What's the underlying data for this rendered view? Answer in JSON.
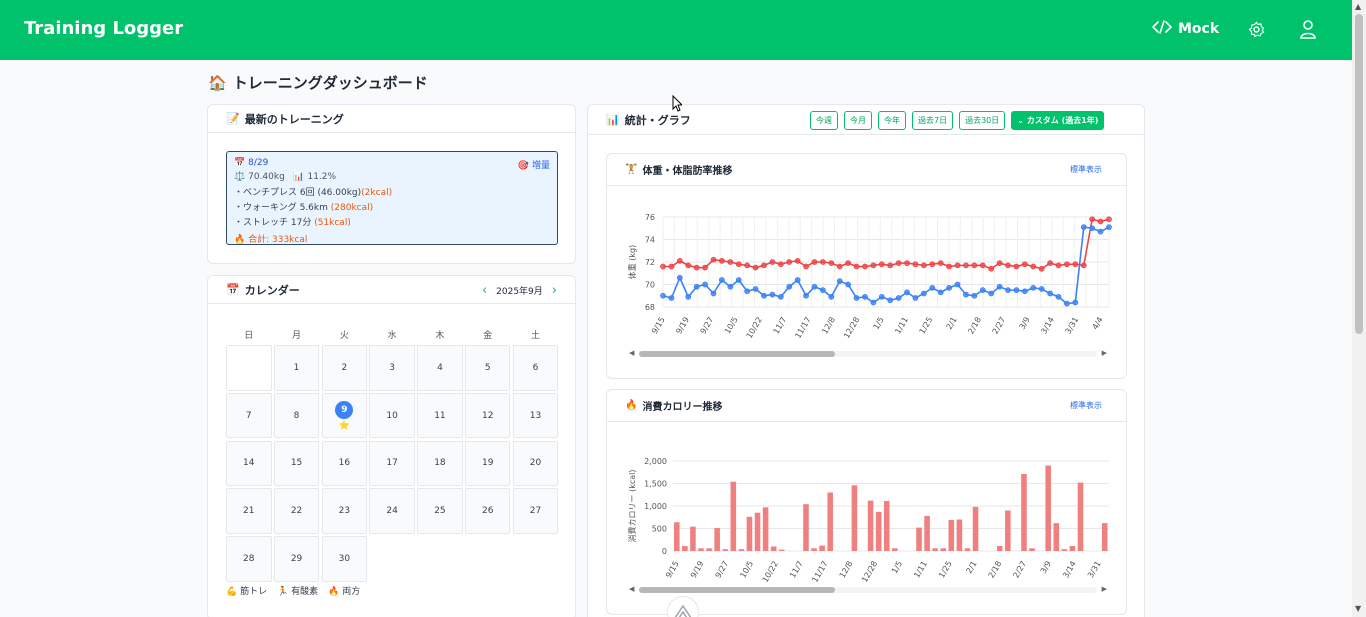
{
  "app": {
    "title": "Training Logger",
    "mock_label": "Mock"
  },
  "page": {
    "title": "トレーニングダッシュボード"
  },
  "latest": {
    "title": "最新のトレーニング",
    "date": "8/29",
    "increase": "増量",
    "weight": "70.40kg",
    "body_fat": "11.2%",
    "items": [
      {
        "text": "・ベンチプレス 6回 (46.00kg)",
        "kcal": "(2kcal)"
      },
      {
        "text": "・ウォーキング 5.6km ",
        "kcal": "(280kcal)"
      },
      {
        "text": "・ストレッチ 17分 ",
        "kcal": "(51kcal)"
      }
    ],
    "total": "合計: 333kcal"
  },
  "calendar": {
    "title": "カレンダー",
    "month": "2025年9月",
    "weekdays": [
      "日",
      "月",
      "火",
      "水",
      "木",
      "金",
      "土"
    ],
    "days": [
      "",
      "1",
      "2",
      "3",
      "4",
      "5",
      "6",
      "7",
      "8",
      "9",
      "10",
      "11",
      "12",
      "13",
      "14",
      "15",
      "16",
      "17",
      "18",
      "19",
      "20",
      "21",
      "22",
      "23",
      "24",
      "25",
      "26",
      "27",
      "28",
      "29",
      "30"
    ],
    "today": "9",
    "legend": [
      {
        "icon": "💪",
        "label": "筋トレ"
      },
      {
        "icon": "🏃",
        "label": "有酸素"
      },
      {
        "icon": "🔥",
        "label": "両方"
      }
    ]
  },
  "stats": {
    "title": "統計・グラフ",
    "ranges": [
      "今週",
      "今月",
      "今年",
      "過去7日",
      "過去30日"
    ],
    "custom": "カスタム (過去1年)"
  },
  "weight_chart": {
    "title": "体重・体脂肪率推移",
    "link": "標準表示",
    "chart_data": {
      "type": "line",
      "ylabel": "体重 (kg)",
      "ylim": [
        68,
        76
      ],
      "yticks": [
        68,
        70,
        72,
        74,
        76
      ],
      "x_labels": [
        "9/15",
        "9/19",
        "9/27",
        "10/5",
        "10/22",
        "11/7",
        "11/17",
        "12/8",
        "12/28",
        "1/5",
        "1/11",
        "1/25",
        "2/1",
        "2/18",
        "2/27",
        "3/9",
        "3/14",
        "3/31",
        "4/4"
      ],
      "series": [
        {
          "name": "red",
          "color": "#ef4444",
          "values": [
            71.6,
            71.6,
            72.1,
            71.7,
            71.5,
            71.5,
            72.2,
            72.1,
            72.0,
            71.8,
            71.7,
            71.5,
            71.7,
            72.0,
            71.8,
            72.0,
            72.1,
            71.6,
            72.0,
            72.0,
            71.9,
            71.6,
            71.9,
            71.6,
            71.6,
            71.7,
            71.8,
            71.7,
            71.9,
            71.9,
            71.8,
            71.7,
            71.8,
            71.9,
            71.6,
            71.7,
            71.7,
            71.7,
            71.7,
            71.4,
            71.9,
            71.7,
            71.6,
            71.8,
            71.6,
            71.4,
            71.9,
            71.7,
            71.8,
            71.8,
            71.7,
            75.8,
            75.6,
            75.8
          ]
        },
        {
          "name": "blue",
          "color": "#3b82f6",
          "values": [
            69.0,
            68.8,
            70.6,
            68.9,
            69.8,
            70.0,
            69.2,
            70.4,
            69.8,
            70.4,
            69.4,
            69.6,
            69.0,
            69.1,
            68.9,
            69.8,
            70.4,
            69.0,
            69.8,
            69.5,
            68.9,
            70.3,
            70.0,
            68.8,
            68.9,
            68.4,
            68.9,
            68.6,
            68.8,
            69.3,
            68.8,
            69.2,
            69.7,
            69.3,
            69.7,
            70.0,
            69.1,
            69.0,
            69.5,
            69.2,
            69.8,
            69.5,
            69.5,
            69.4,
            69.7,
            69.6,
            69.2,
            68.9,
            68.3,
            68.4,
            75.1,
            75.0,
            74.7,
            75.1
          ]
        }
      ]
    }
  },
  "calorie_chart": {
    "title": "消費カロリー推移",
    "link": "標準表示",
    "chart_data": {
      "type": "bar",
      "ylabel": "消費カロリー (kcal)",
      "ylim": [
        0,
        2000
      ],
      "yticks": [
        "0",
        "500",
        "1,000",
        "1,500",
        "2,000"
      ],
      "x_labels": [
        "9/15",
        "9/19",
        "9/27",
        "10/5",
        "10/22",
        "11/7",
        "11/17",
        "12/8",
        "12/28",
        "1/5",
        "1/11",
        "1/25",
        "2/1",
        "2/18",
        "2/27",
        "3/9",
        "3/14",
        "3/31"
      ],
      "color": "#f08080",
      "values": [
        640,
        110,
        540,
        60,
        60,
        510,
        40,
        1540,
        40,
        760,
        850,
        970,
        100,
        30,
        0,
        0,
        1040,
        60,
        120,
        1300,
        0,
        0,
        1460,
        0,
        1120,
        870,
        1110,
        60,
        0,
        0,
        520,
        780,
        60,
        60,
        690,
        700,
        60,
        980,
        0,
        0,
        110,
        900,
        0,
        1710,
        60,
        0,
        1900,
        620,
        40,
        110,
        1520,
        0,
        0,
        620
      ]
    }
  }
}
